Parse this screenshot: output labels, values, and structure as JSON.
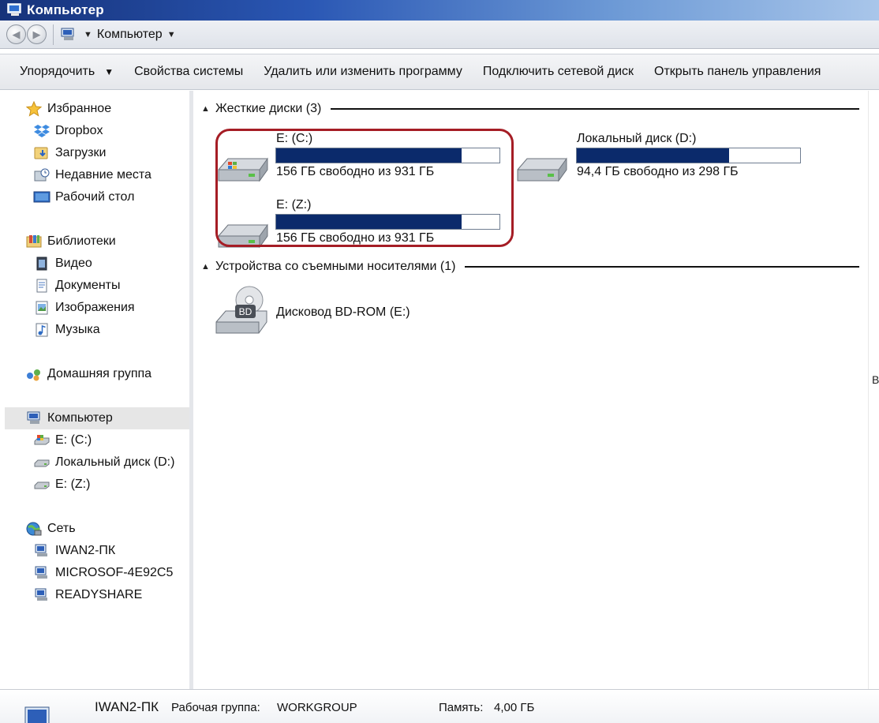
{
  "window": {
    "title": "Компьютер"
  },
  "address": {
    "path": "Компьютер"
  },
  "toolbar": {
    "organize": "Упорядочить",
    "system_properties": "Свойства системы",
    "uninstall": "Удалить или изменить программу",
    "map_drive": "Подключить сетевой диск",
    "control_panel": "Открыть панель управления"
  },
  "nav": {
    "favorites": "Избранное",
    "dropbox": "Dropbox",
    "downloads": "Загрузки",
    "recent": "Недавние места",
    "desktop": "Рабочий стол",
    "libraries": "Библиотеки",
    "video": "Видео",
    "documents": "Документы",
    "images": "Изображения",
    "music": "Музыка",
    "homegroup": "Домашняя группа",
    "computer": "Компьютер",
    "drive_c": "E: (C:)",
    "drive_d": "Локальный диск (D:)",
    "drive_z": "E: (Z:)",
    "network": "Сеть",
    "net_1": "IWAN2-ПК",
    "net_2": "MICROSOF-4E92C5",
    "net_3": "READYSHARE"
  },
  "groups": {
    "hard_disks": "Жесткие диски (3)",
    "removable": "Устройства со съемными носителями (1)"
  },
  "drives": {
    "c": {
      "name": "E: (C:)",
      "info": "156 ГБ свободно из 931 ГБ",
      "used_fraction": 0.832
    },
    "d": {
      "name": "Локальный диск (D:)",
      "info": "94,4 ГБ свободно из 298 ГБ",
      "used_fraction": 0.683
    },
    "z": {
      "name": "E: (Z:)",
      "info": "156 ГБ свободно из 931 ГБ",
      "used_fraction": 0.832
    },
    "bd": {
      "name": "Дисковод BD-ROM (E:)",
      "badge": "BD"
    }
  },
  "details": {
    "pc_name": "IWAN2-ПК",
    "workgroup_label": "Рабочая группа:",
    "workgroup_value": "WORKGROUP",
    "memory_label": "Память:",
    "memory_value": "4,00 ГБ"
  },
  "edge_text": "В",
  "colors": {
    "usage_bar": "#0b2a6b",
    "highlight_ring": "#a51d25",
    "title_bar": "#16327a"
  }
}
